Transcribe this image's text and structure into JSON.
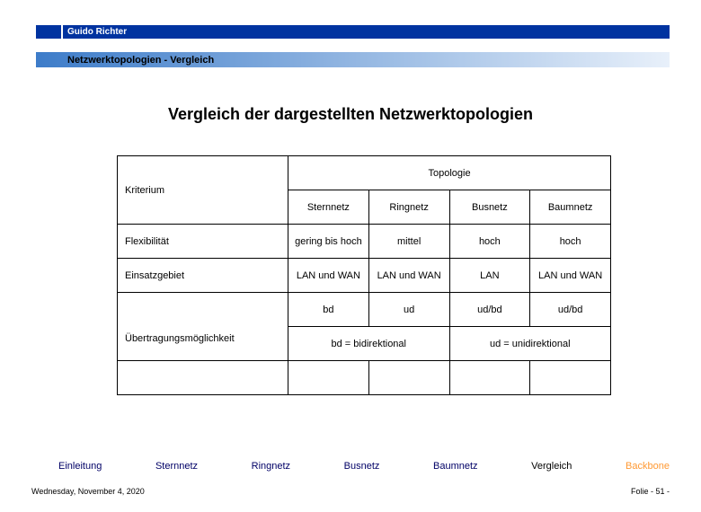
{
  "header": {
    "author": "Guido Richter",
    "breadcrumb": "Netzwerktopologien  - Vergleich"
  },
  "main_title": "Vergleich der dargestellten Netzwerktopologien",
  "table": {
    "kriterium_label": "Kriterium",
    "topologie_label": "Topologie",
    "columns": [
      "Sternnetz",
      "Ringnetz",
      "Busnetz",
      "Baumnetz"
    ],
    "rows": [
      {
        "label": "Flexibilität",
        "cells": [
          "gering bis hoch",
          "mittel",
          "hoch",
          "hoch"
        ]
      },
      {
        "label": "Einsatzgebiet",
        "cells": [
          "LAN und WAN",
          "LAN und WAN",
          "LAN",
          "LAN und WAN"
        ]
      }
    ],
    "transfer_label": "Übertragungsmöglichkeit",
    "transfer_cells": [
      "bd",
      "ud",
      "ud/bd",
      "ud/bd"
    ],
    "legend": {
      "bd": "bd = bidirektional",
      "ud": "ud = unidirektional"
    }
  },
  "nav": {
    "items": [
      "Einleitung",
      "Sternnetz",
      "Ringnetz",
      "Busnetz",
      "Baumnetz",
      "Vergleich",
      "Backbone"
    ]
  },
  "footer": {
    "date": "Wednesday, November 4, 2020",
    "page": "Folie - 51 -"
  }
}
